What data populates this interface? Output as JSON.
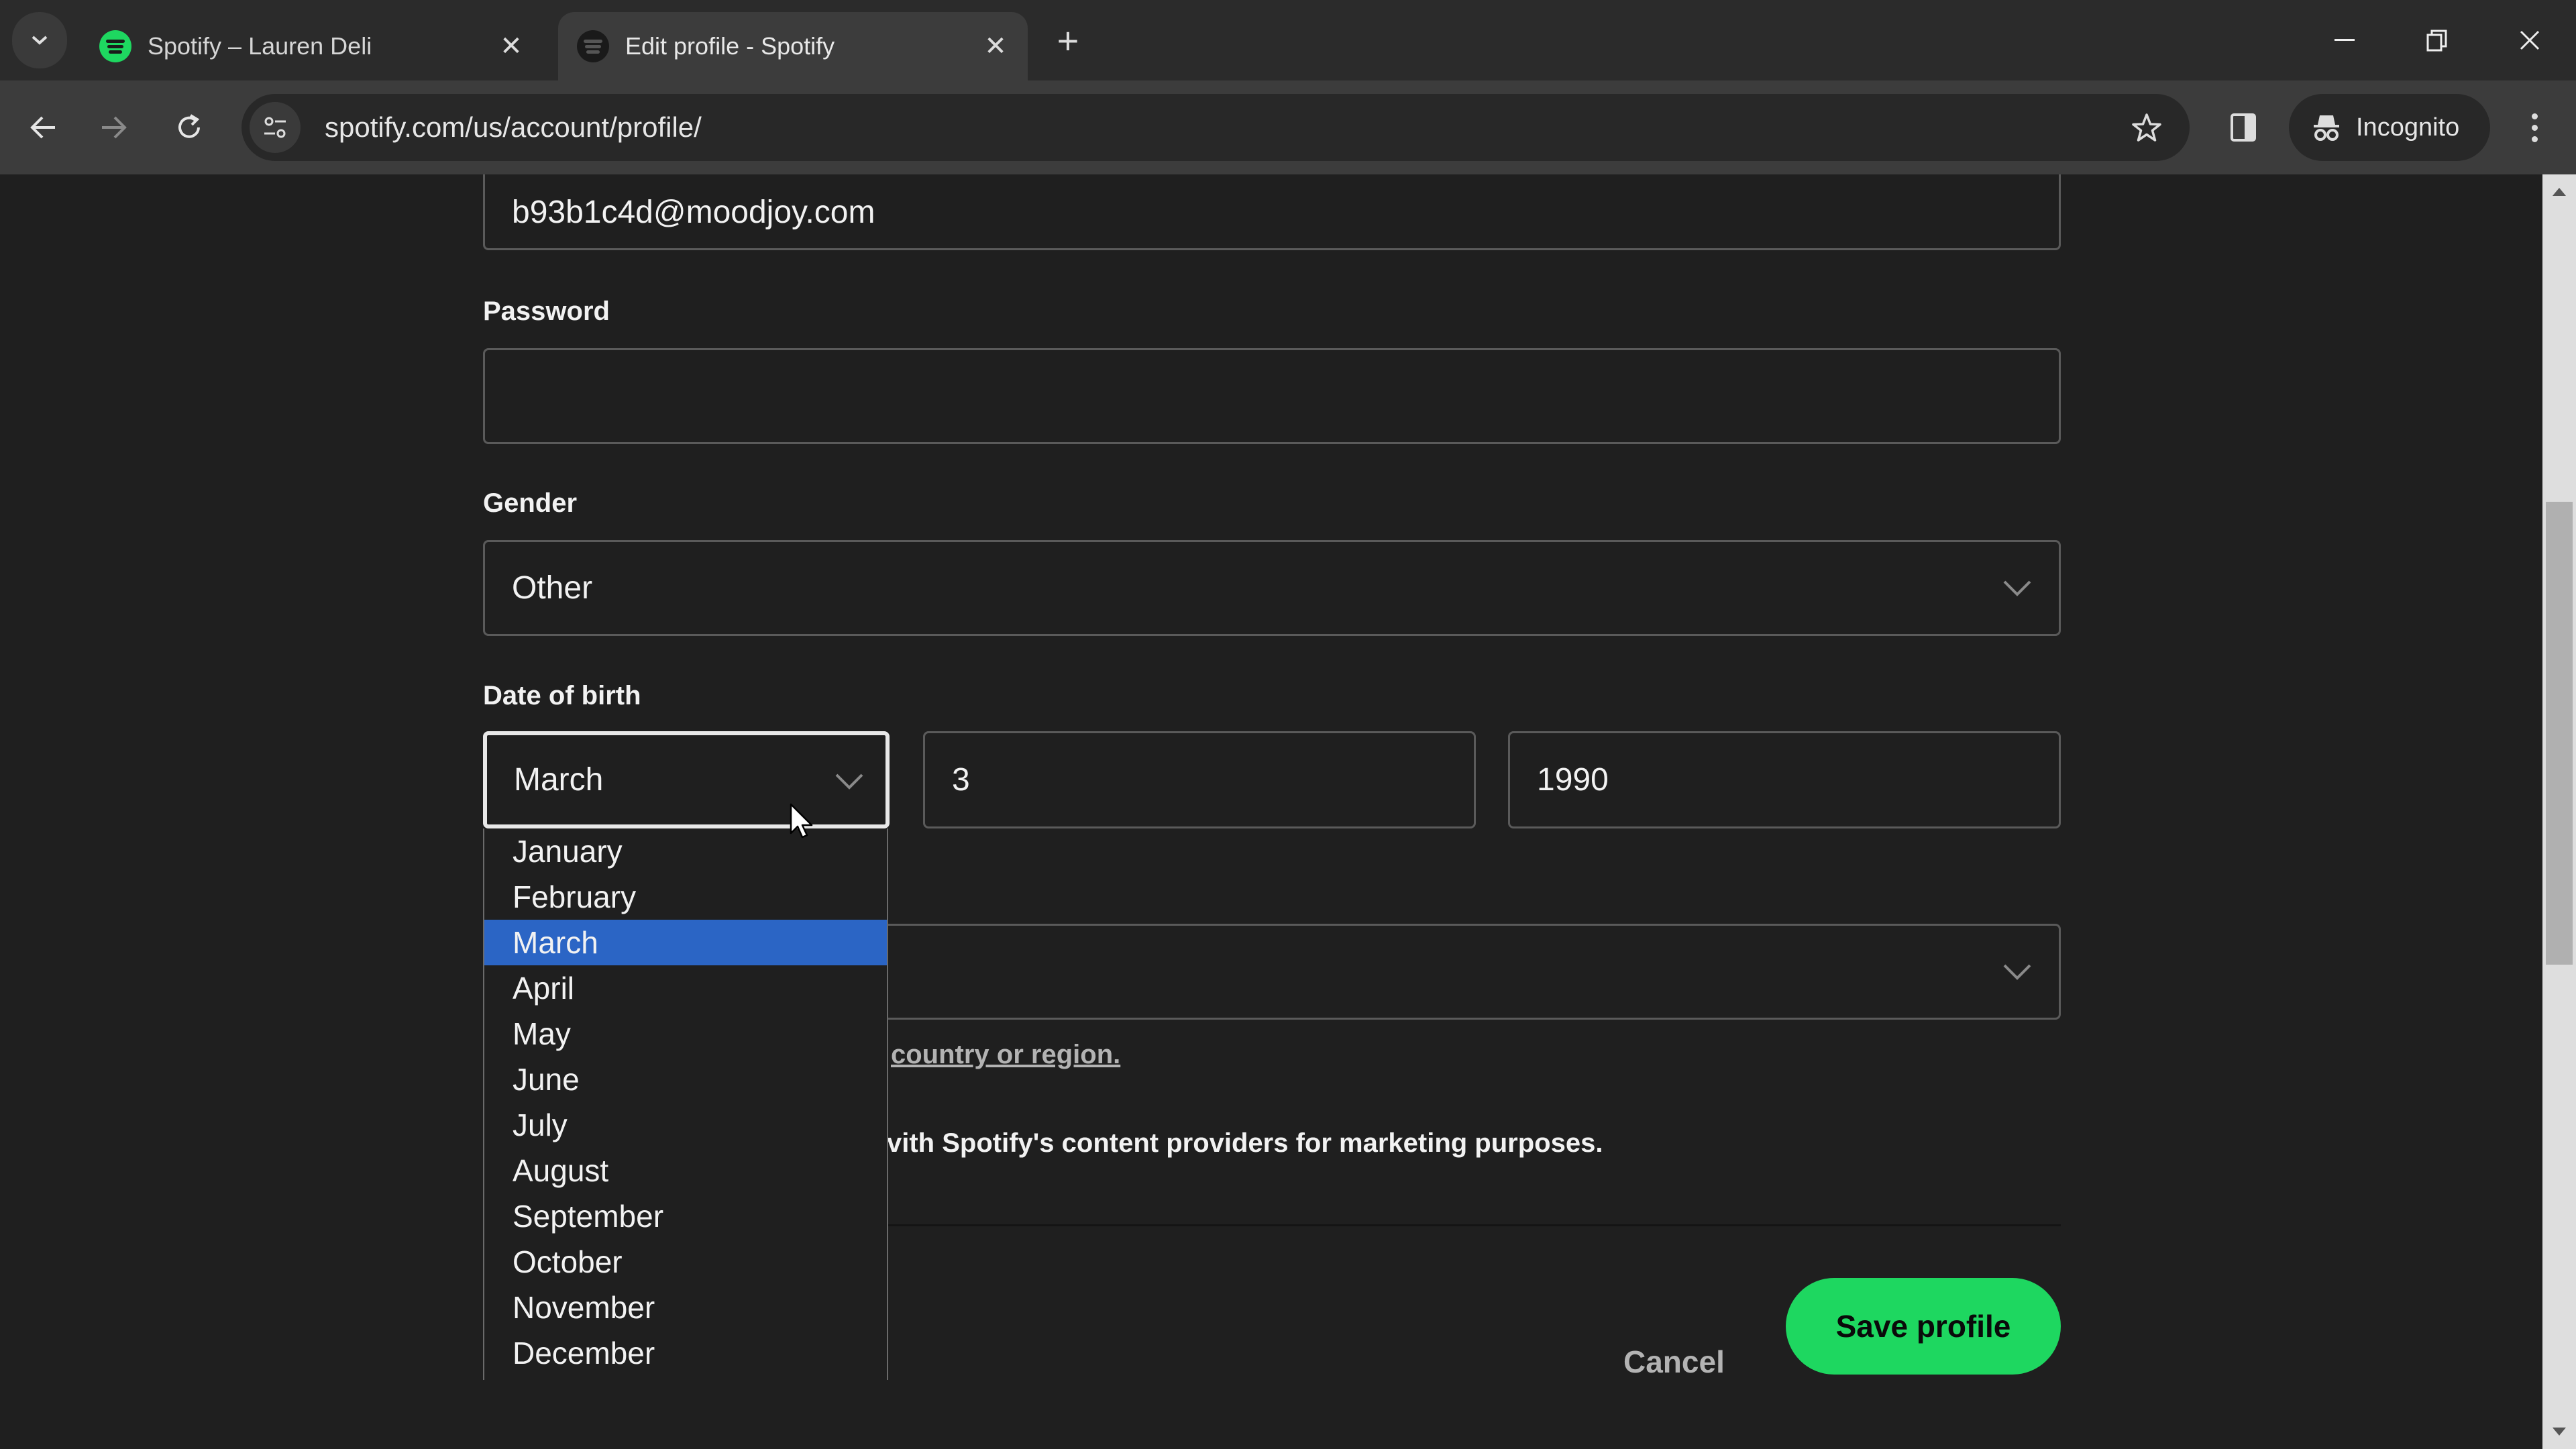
{
  "browser": {
    "tabs": [
      {
        "title": "Spotify – Lauren Deli",
        "active": false
      },
      {
        "title": "Edit profile - Spotify",
        "active": true
      }
    ],
    "url": "spotify.com/us/account/profile/",
    "incognito_label": "Incognito"
  },
  "form": {
    "email_value": "b93b1c4d@moodjoy.com",
    "password_label": "Password",
    "password_value": "",
    "gender_label": "Gender",
    "gender_value": "Other",
    "dob_label": "Date of birth",
    "dob_month": "March",
    "dob_day": "3",
    "dob_year": "1990",
    "country_value": "",
    "country_link_text": "country or region.",
    "marketing_text": "vith Spotify's content providers for marketing purposes."
  },
  "month_dropdown": {
    "options": [
      "January",
      "February",
      "March",
      "April",
      "May",
      "June",
      "July",
      "August",
      "September",
      "October",
      "November",
      "December"
    ],
    "selected": "March"
  },
  "actions": {
    "cancel_label": "Cancel",
    "save_label": "Save profile"
  },
  "colors": {
    "spotify_green": "#1ed760",
    "selection_blue": "#2b65c5",
    "page_bg": "#1f1f1f"
  }
}
